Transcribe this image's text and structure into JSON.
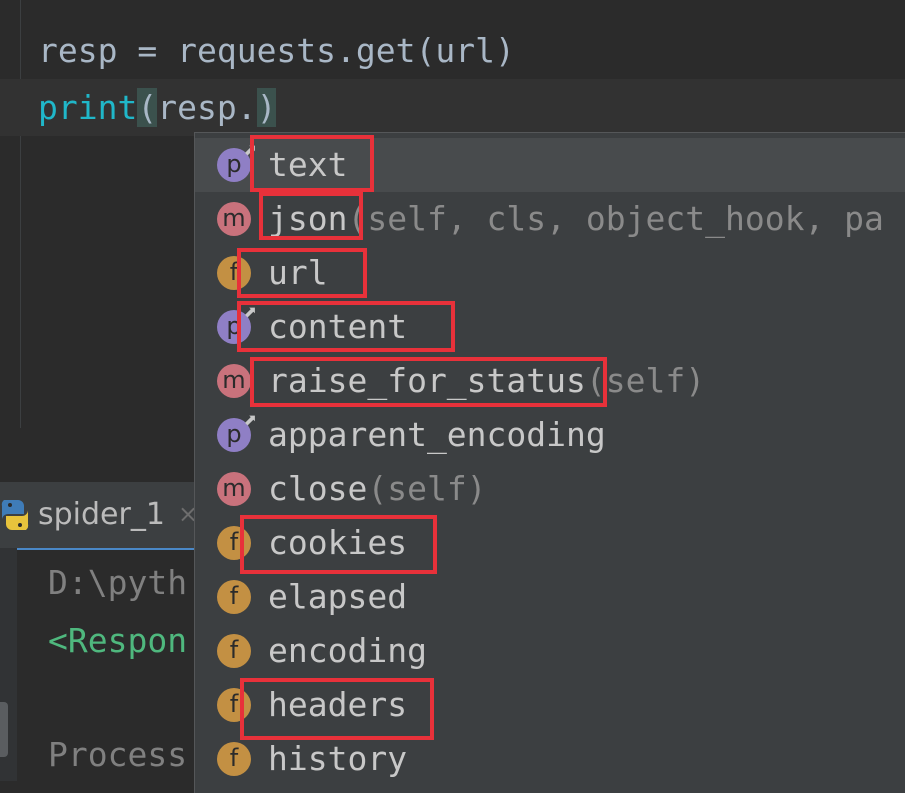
{
  "editor": {
    "line1": {
      "var": "resp",
      "op": " = ",
      "call": "requests.get(url)"
    },
    "line2": {
      "func": "print",
      "open": "(",
      "expr": "resp.",
      "close": ")"
    }
  },
  "completion": {
    "items": [
      {
        "kind": "p",
        "name": "text",
        "signature": "",
        "highlighted": true,
        "selected": true
      },
      {
        "kind": "m",
        "name": "json",
        "signature": "(self, cls, object_hook, pa",
        "highlighted": true
      },
      {
        "kind": "f",
        "name": "url",
        "signature": "",
        "highlighted": true
      },
      {
        "kind": "p",
        "name": "content",
        "signature": "",
        "highlighted": true
      },
      {
        "kind": "m",
        "name": "raise_for_status",
        "signature": "(self)",
        "highlighted": true
      },
      {
        "kind": "p",
        "name": "apparent_encoding",
        "signature": "",
        "highlighted": false
      },
      {
        "kind": "m",
        "name": "close",
        "signature": "(self)",
        "highlighted": false
      },
      {
        "kind": "f",
        "name": "cookies",
        "signature": "",
        "highlighted": true
      },
      {
        "kind": "f",
        "name": "elapsed",
        "signature": "",
        "highlighted": false
      },
      {
        "kind": "f",
        "name": "encoding",
        "signature": "",
        "highlighted": false
      },
      {
        "kind": "f",
        "name": "headers",
        "signature": "",
        "highlighted": true
      },
      {
        "kind": "f",
        "name": "history",
        "signature": "",
        "highlighted": false
      }
    ],
    "kind_labels": {
      "p": "p",
      "m": "m",
      "f": "f"
    }
  },
  "run_tab": {
    "label": "spider_1",
    "close": "×"
  },
  "console": {
    "line1": "D:\\pyth",
    "line2": "<Respon",
    "line3": "Process"
  },
  "colors": {
    "highlight_box": "#e8313a",
    "property_badge": "#8f7fc5",
    "method_badge": "#c9727c",
    "field_badge": "#c39043"
  },
  "icons": {
    "tab_icon": "python-icon",
    "property_lock": "lock-icon"
  }
}
